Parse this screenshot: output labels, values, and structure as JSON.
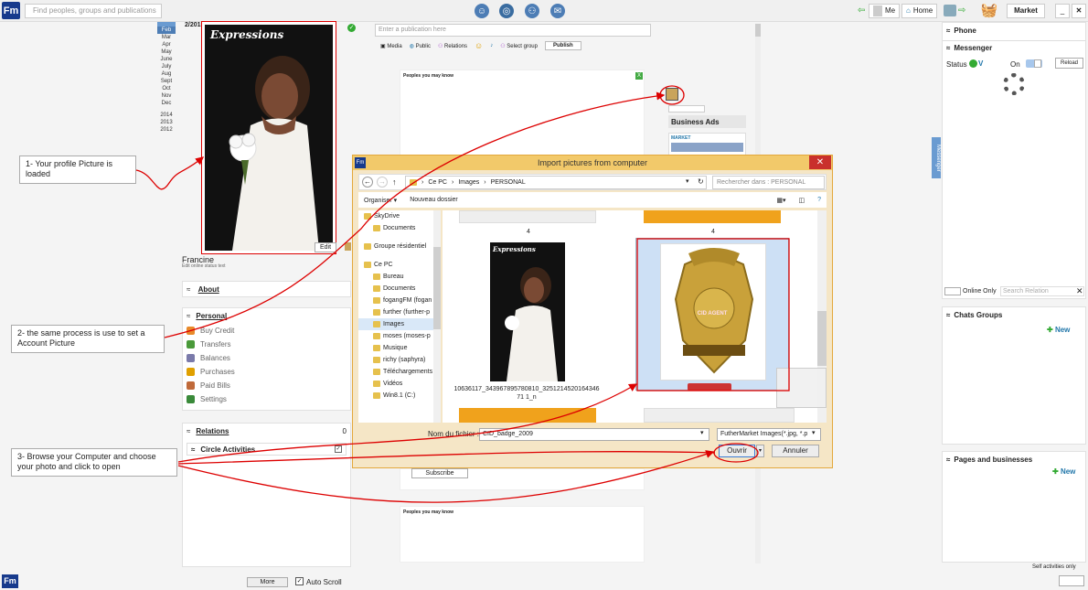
{
  "topbar": {
    "logo": "Fm",
    "search_placeholder": "Find peoples, groups and publications",
    "me": "Me",
    "home": "Home",
    "market": "Market"
  },
  "calendar": {
    "months": [
      "Feb",
      "Mar",
      "Apr",
      "May",
      "June",
      "July",
      "Aug",
      "Sept",
      "Oct",
      "Nov",
      "Dec"
    ],
    "years": [
      "2014",
      "2013",
      "2012"
    ]
  },
  "profile": {
    "date": "2/2015",
    "cover_title": "Expressions",
    "edit": "Edit",
    "name": "Francine",
    "status_text": "Edit online status text"
  },
  "left": {
    "about": "About",
    "personal": "Personal",
    "items": [
      "Buy Credit",
      "Transfers",
      "Balances",
      "Purchases",
      "Paid Bills",
      "Settings"
    ],
    "relations": "Relations",
    "relations_count": "0",
    "circle": "Circle Activities",
    "more": "More",
    "autoscroll": "Auto Scroll"
  },
  "center": {
    "pub_placeholder": "Enter a publication here",
    "toolbar": [
      "Media",
      "Public",
      "Relations",
      "Select group"
    ],
    "publish": "Publish",
    "peoples": "Peoples you may know",
    "close": "X",
    "subscribe": "Subscribe"
  },
  "ads": {
    "title": "Business Ads",
    "market": "MARKET"
  },
  "right": {
    "phone": "Phone",
    "messenger": "Messenger",
    "status": "Status",
    "on": "On",
    "reload": "Reload",
    "online_only": "Online Only",
    "search_relation": "Search Relation",
    "chats_groups": "Chats Groups",
    "new": "New",
    "pages": "Pages and businesses",
    "self_activities": "Self activities only",
    "vertical_tab": "Messenger"
  },
  "dialog": {
    "title": "Import pictures from computer",
    "path": [
      "Ce PC",
      "Images",
      "PERSONAL"
    ],
    "search_placeholder": "Rechercher dans : PERSONAL",
    "organize": "Organiser",
    "new_folder": "Nouveau dossier",
    "nav": [
      {
        "label": "SkyDrive",
        "indent": 0
      },
      {
        "label": "Documents",
        "indent": 1
      },
      {
        "label": "Groupe résidentiel",
        "indent": 0
      },
      {
        "label": "Ce PC",
        "indent": 0
      },
      {
        "label": "Bureau",
        "indent": 1
      },
      {
        "label": "Documents",
        "indent": 1
      },
      {
        "label": "fogangFM (fogan",
        "indent": 1
      },
      {
        "label": "further (further-p",
        "indent": 1
      },
      {
        "label": "Images",
        "indent": 1
      },
      {
        "label": "moses (moses-p",
        "indent": 1
      },
      {
        "label": "Musique",
        "indent": 1
      },
      {
        "label": "richy (saphyra)",
        "indent": 1
      },
      {
        "label": "Téléchargements",
        "indent": 1
      },
      {
        "label": "Vidéos",
        "indent": 1
      },
      {
        "label": "Win8.1 (C:)",
        "indent": 1
      }
    ],
    "file_top_labels": [
      "4",
      "4"
    ],
    "photo_thumb_title": "Expressions",
    "file1_name": "10636117_343967895780810_325121452016434671 1_n",
    "badge_text": "CID AGENT",
    "filename_label": "Nom du fichier :",
    "filename_value": "CID_badge_2009",
    "filetype": "FutherMarket Images(*.jpg, *.p",
    "open": "Ouvrir",
    "cancel": "Annuler"
  },
  "annotations": [
    "1- Your profile Picture is loaded",
    "2- the same process is use to set a Account Picture",
    "3- Browse your Computer and choose your photo  and click to open"
  ]
}
